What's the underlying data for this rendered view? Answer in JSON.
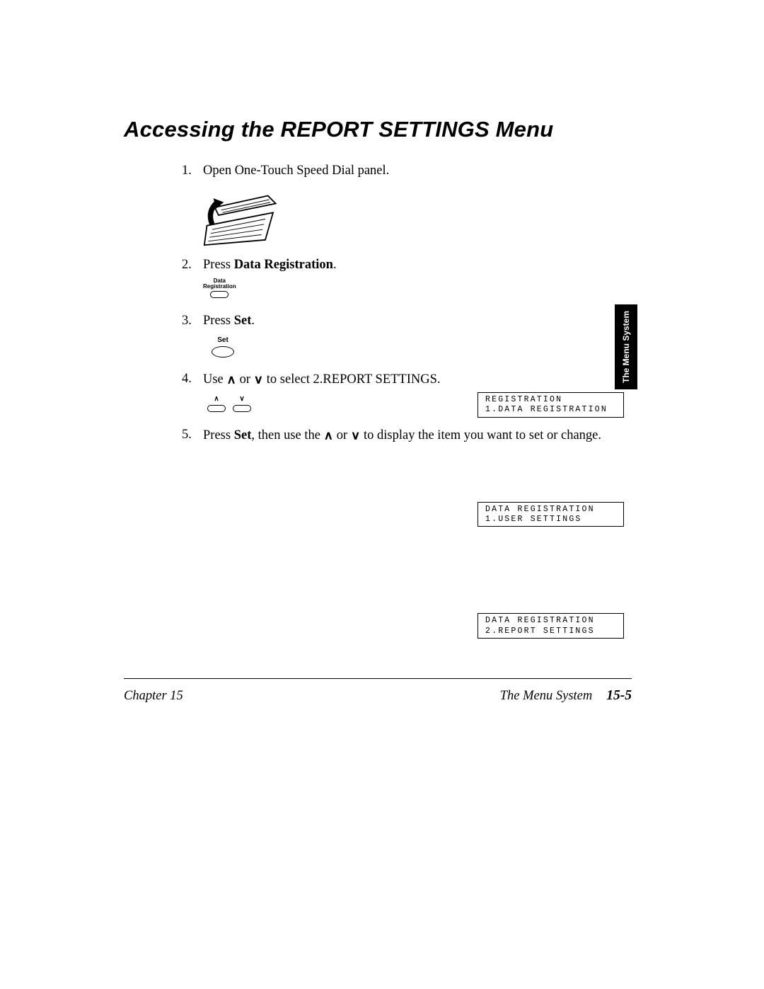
{
  "title": "Accessing the REPORT SETTINGS Menu",
  "steps": {
    "s1": {
      "text": "Open One-Touch Speed Dial panel."
    },
    "s2": {
      "prefix": "Press ",
      "bold": "Data Registration",
      "suffix": "."
    },
    "s3": {
      "prefix": "Press ",
      "bold": "Set",
      "suffix": "."
    },
    "s4": {
      "prefix": "Use ",
      "mid": " or ",
      "suffix": " to select 2.REPORT SETTINGS."
    },
    "s5": {
      "prefix": "Press ",
      "bold": "Set",
      "mid1": ", then use the ",
      "mid2": " or ",
      "suffix": " to display the item you want to set or change."
    }
  },
  "buttons": {
    "data_reg_label": "Data\nRegistration",
    "set_label": "Set",
    "up_label": "∧",
    "down_label": "∨"
  },
  "lcd": {
    "lcd1_line1": "REGISTRATION",
    "lcd1_line2": "1.DATA REGISTRATION",
    "lcd2_line1": "DATA REGISTRATION",
    "lcd2_line2": "1.USER SETTINGS",
    "lcd3_line1": "DATA REGISTRATION",
    "lcd3_line2": "2.REPORT SETTINGS"
  },
  "side_tab": "The Menu System",
  "footer": {
    "chapter": "Chapter 15",
    "section": "The Menu System",
    "page": "15-5"
  },
  "glyphs": {
    "up": "∧",
    "down": "∨"
  }
}
